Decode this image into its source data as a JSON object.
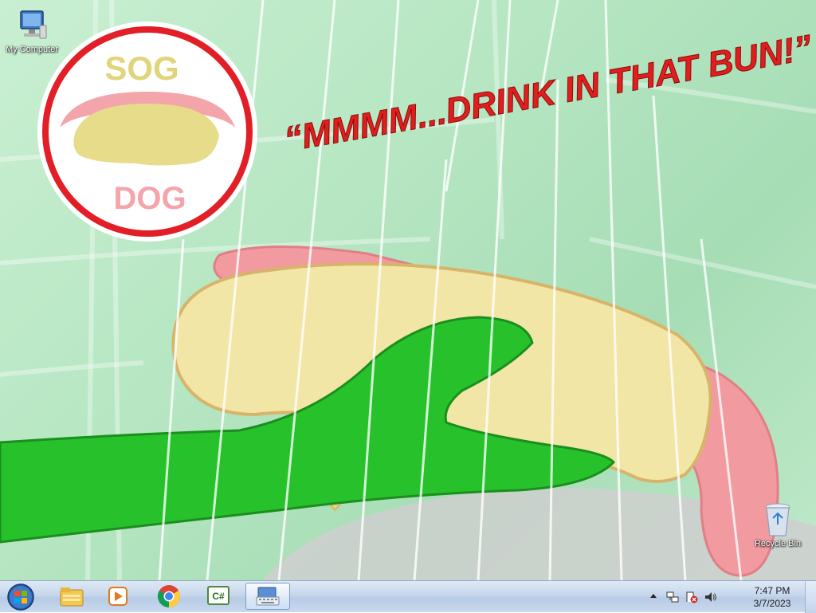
{
  "desktop": {
    "icons": [
      {
        "label": "My Computer",
        "icon": "computer-icon"
      },
      {
        "label": "Recycle Bin",
        "icon": "recycle-bin-icon"
      }
    ],
    "wallpaper": {
      "logo_top": "SOG",
      "logo_bottom": "DOG",
      "slogan": "“MMMM...DRINK IN THAT BUN!”",
      "colors": {
        "background": "#b6e6c2",
        "slogan": "#e01e1e",
        "logo_ring": "#e21f26",
        "bun": "#f2e6a6",
        "hotdog": "#f19aa0",
        "hand": "#27c22b"
      }
    }
  },
  "taskbar": {
    "start": {
      "icon": "windows-start-icon"
    },
    "pinned": [
      {
        "icon": "file-explorer-icon"
      },
      {
        "icon": "media-player-icon"
      },
      {
        "icon": "chrome-icon"
      },
      {
        "icon": "csharp-editor-icon"
      },
      {
        "icon": "on-screen-keyboard-icon",
        "active": true
      }
    ],
    "tray": {
      "icons": [
        "show-hidden-icons-chevron-icon",
        "network-icon",
        "action-center-error-icon",
        "volume-icon"
      ],
      "time": "7:47 PM",
      "date": "3/7/2023"
    }
  }
}
